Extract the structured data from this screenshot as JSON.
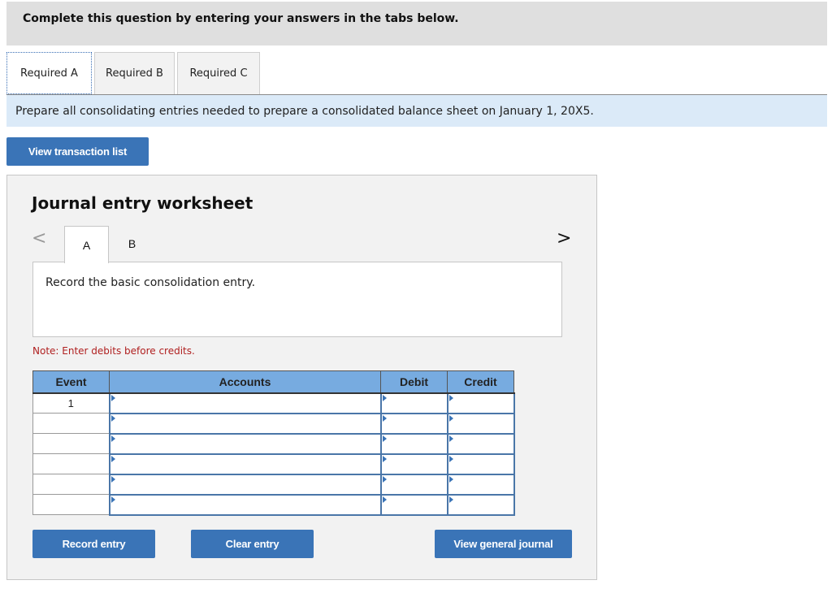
{
  "banner": {
    "text": "Complete this question by entering your answers in the tabs below."
  },
  "required_tabs": [
    {
      "label": "Required A",
      "active": true
    },
    {
      "label": "Required B",
      "active": false
    },
    {
      "label": "Required C",
      "active": false
    }
  ],
  "instruction": "Prepare all consolidating entries needed to prepare a consolidated balance sheet on January 1, 20X5.",
  "view_transaction_list_label": "View transaction list",
  "worksheet": {
    "title": "Journal entry worksheet",
    "nav_prev_icon": "chevron-left-icon",
    "nav_prev_glyph": "<",
    "nav_next_icon": "chevron-right-icon",
    "nav_next_glyph": ">",
    "entry_tabs": [
      {
        "label": "A",
        "active": true
      },
      {
        "label": "B",
        "active": false
      }
    ],
    "description": "Record the basic consolidation entry.",
    "note": "Note: Enter debits before credits.",
    "table": {
      "headers": [
        "Event",
        "Accounts",
        "Debit",
        "Credit"
      ],
      "rows": [
        {
          "event": "1",
          "account": "",
          "debit": "",
          "credit": ""
        },
        {
          "event": "",
          "account": "",
          "debit": "",
          "credit": ""
        },
        {
          "event": "",
          "account": "",
          "debit": "",
          "credit": ""
        },
        {
          "event": "",
          "account": "",
          "debit": "",
          "credit": ""
        },
        {
          "event": "",
          "account": "",
          "debit": "",
          "credit": ""
        },
        {
          "event": "",
          "account": "",
          "debit": "",
          "credit": ""
        }
      ]
    },
    "buttons": {
      "record": "Record entry",
      "clear": "Clear entry",
      "view_journal": "View general journal"
    }
  },
  "colors": {
    "button_blue": "#3a74b7",
    "header_blue": "#77abe0",
    "instruction_bg": "#dbeaf8",
    "note_red": "#b02020",
    "banner_gray": "#dfdfdf",
    "worksheet_bg": "#f2f2f2"
  }
}
